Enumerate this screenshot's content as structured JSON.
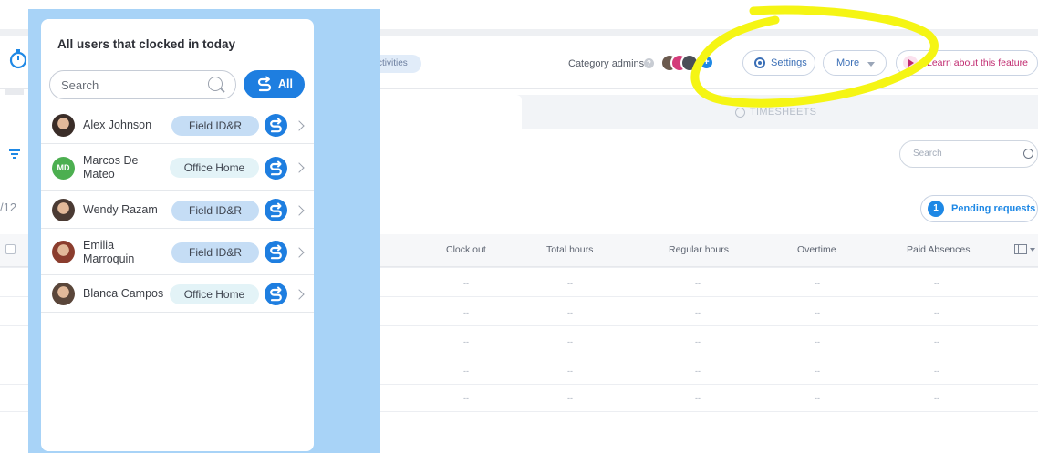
{
  "header": {
    "activities_link": "ctivities",
    "category_admins_label": "Category admins",
    "help_glyph": "?",
    "add_glyph": "+",
    "settings_label": "Settings",
    "more_label": "More",
    "learn_label": "Learn about this feature"
  },
  "tabs": {
    "timesheets": "TIMESHEETS"
  },
  "toolbar": {
    "search_placeholder": "Search",
    "date_fragment": "/12",
    "pending_count": "1",
    "pending_label": "Pending requests"
  },
  "table": {
    "columns": [
      "Clock out",
      "Total hours",
      "Regular hours",
      "Overtime",
      "Paid Absences"
    ],
    "empty_cell": "--"
  },
  "panel": {
    "title": "All users that clocked in today",
    "search_placeholder": "Search",
    "all_button": "All",
    "users": [
      {
        "name": "Alex Johnson",
        "tag": "Field ID&R",
        "avatar_type": "photo"
      },
      {
        "name": "Marcos De Mateo",
        "name_line1": "Marcos De",
        "name_line2": "Mateo",
        "tag": "Office Home",
        "avatar_type": "initials",
        "initials": "MD"
      },
      {
        "name": "Wendy Razam",
        "tag": "Field ID&R",
        "avatar_type": "photo"
      },
      {
        "name": "Emilia Marroquin",
        "name_line1": "Emilia",
        "name_line2": "Marroquin",
        "tag": "Field ID&R",
        "avatar_type": "photo"
      },
      {
        "name": "Blanca Campos",
        "tag": "Office Home",
        "avatar_type": "photo"
      }
    ]
  },
  "colors": {
    "accent": "#1e7ee0",
    "backdrop": "#a8d3f7",
    "annotation": "#f5f514",
    "learn_accent": "#c0296f",
    "initials_avatar": "#4caf50"
  },
  "icons": [
    "stopwatch-icon",
    "help-icon",
    "gear-icon",
    "caret-down-icon",
    "play-icon",
    "clock-icon",
    "filter-icon",
    "search-icon",
    "columns-icon",
    "sync-icon",
    "chevron-right-icon"
  ]
}
